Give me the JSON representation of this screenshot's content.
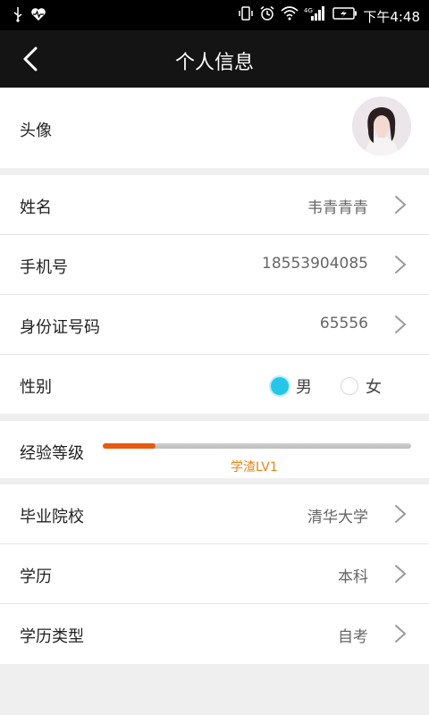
{
  "status_bar": {
    "time": "下午4:48",
    "left_icons": [
      "usb-icon",
      "heart-icon"
    ],
    "right_icons": [
      "vibrate-icon",
      "alarm-icon",
      "wifi-icon",
      "signal-4g-icon",
      "battery-charging-icon"
    ]
  },
  "header": {
    "title": "个人信息"
  },
  "profile": {
    "avatar_label": "头像",
    "name_label": "姓名",
    "name_value": "韦青青青",
    "phone_label": "手机号",
    "phone_value": "18553904085",
    "id_label": "身份证号码",
    "id_value": "65556",
    "gender_label": "性别",
    "gender_options": [
      "男",
      "女"
    ],
    "gender_selected": "男"
  },
  "experience": {
    "label": "经验等级",
    "level_text": "学渣LV1",
    "progress_fraction": 0.17
  },
  "education": {
    "school_label": "毕业院校",
    "school_value": "清华大学",
    "degree_label": "学历",
    "degree_value": "本科",
    "degree_type_label": "学历类型",
    "degree_type_value": "自考"
  },
  "colors": {
    "accent": "#25c6e8",
    "progress": "#e85a10",
    "level_text": "#e8841a",
    "header_bg": "#141414"
  }
}
